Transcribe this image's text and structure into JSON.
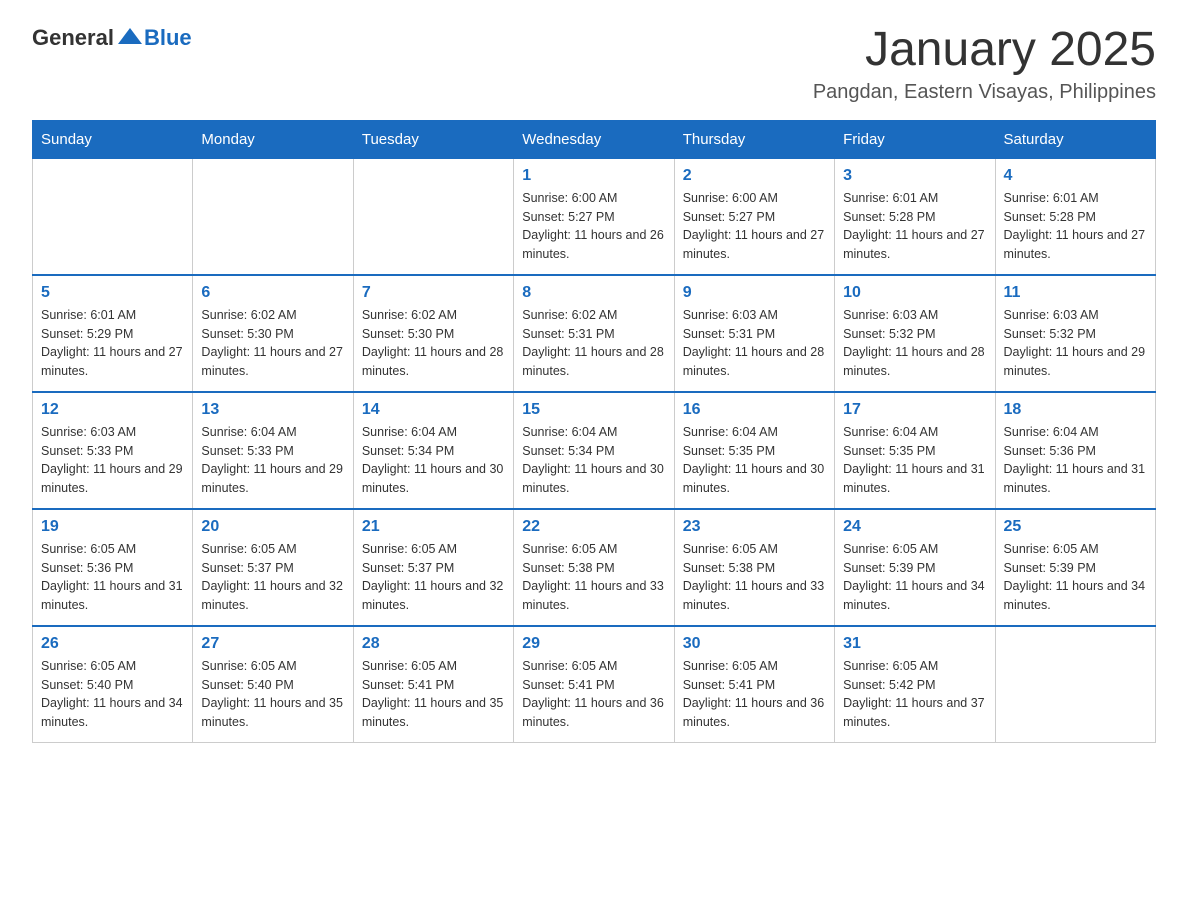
{
  "header": {
    "logo_general": "General",
    "logo_blue": "Blue",
    "month_title": "January 2025",
    "location": "Pangdan, Eastern Visayas, Philippines"
  },
  "days_of_week": [
    "Sunday",
    "Monday",
    "Tuesday",
    "Wednesday",
    "Thursday",
    "Friday",
    "Saturday"
  ],
  "weeks": [
    {
      "days": [
        {
          "num": "",
          "info": ""
        },
        {
          "num": "",
          "info": ""
        },
        {
          "num": "",
          "info": ""
        },
        {
          "num": "1",
          "info": "Sunrise: 6:00 AM\nSunset: 5:27 PM\nDaylight: 11 hours and 26 minutes."
        },
        {
          "num": "2",
          "info": "Sunrise: 6:00 AM\nSunset: 5:27 PM\nDaylight: 11 hours and 27 minutes."
        },
        {
          "num": "3",
          "info": "Sunrise: 6:01 AM\nSunset: 5:28 PM\nDaylight: 11 hours and 27 minutes."
        },
        {
          "num": "4",
          "info": "Sunrise: 6:01 AM\nSunset: 5:28 PM\nDaylight: 11 hours and 27 minutes."
        }
      ]
    },
    {
      "days": [
        {
          "num": "5",
          "info": "Sunrise: 6:01 AM\nSunset: 5:29 PM\nDaylight: 11 hours and 27 minutes."
        },
        {
          "num": "6",
          "info": "Sunrise: 6:02 AM\nSunset: 5:30 PM\nDaylight: 11 hours and 27 minutes."
        },
        {
          "num": "7",
          "info": "Sunrise: 6:02 AM\nSunset: 5:30 PM\nDaylight: 11 hours and 28 minutes."
        },
        {
          "num": "8",
          "info": "Sunrise: 6:02 AM\nSunset: 5:31 PM\nDaylight: 11 hours and 28 minutes."
        },
        {
          "num": "9",
          "info": "Sunrise: 6:03 AM\nSunset: 5:31 PM\nDaylight: 11 hours and 28 minutes."
        },
        {
          "num": "10",
          "info": "Sunrise: 6:03 AM\nSunset: 5:32 PM\nDaylight: 11 hours and 28 minutes."
        },
        {
          "num": "11",
          "info": "Sunrise: 6:03 AM\nSunset: 5:32 PM\nDaylight: 11 hours and 29 minutes."
        }
      ]
    },
    {
      "days": [
        {
          "num": "12",
          "info": "Sunrise: 6:03 AM\nSunset: 5:33 PM\nDaylight: 11 hours and 29 minutes."
        },
        {
          "num": "13",
          "info": "Sunrise: 6:04 AM\nSunset: 5:33 PM\nDaylight: 11 hours and 29 minutes."
        },
        {
          "num": "14",
          "info": "Sunrise: 6:04 AM\nSunset: 5:34 PM\nDaylight: 11 hours and 30 minutes."
        },
        {
          "num": "15",
          "info": "Sunrise: 6:04 AM\nSunset: 5:34 PM\nDaylight: 11 hours and 30 minutes."
        },
        {
          "num": "16",
          "info": "Sunrise: 6:04 AM\nSunset: 5:35 PM\nDaylight: 11 hours and 30 minutes."
        },
        {
          "num": "17",
          "info": "Sunrise: 6:04 AM\nSunset: 5:35 PM\nDaylight: 11 hours and 31 minutes."
        },
        {
          "num": "18",
          "info": "Sunrise: 6:04 AM\nSunset: 5:36 PM\nDaylight: 11 hours and 31 minutes."
        }
      ]
    },
    {
      "days": [
        {
          "num": "19",
          "info": "Sunrise: 6:05 AM\nSunset: 5:36 PM\nDaylight: 11 hours and 31 minutes."
        },
        {
          "num": "20",
          "info": "Sunrise: 6:05 AM\nSunset: 5:37 PM\nDaylight: 11 hours and 32 minutes."
        },
        {
          "num": "21",
          "info": "Sunrise: 6:05 AM\nSunset: 5:37 PM\nDaylight: 11 hours and 32 minutes."
        },
        {
          "num": "22",
          "info": "Sunrise: 6:05 AM\nSunset: 5:38 PM\nDaylight: 11 hours and 33 minutes."
        },
        {
          "num": "23",
          "info": "Sunrise: 6:05 AM\nSunset: 5:38 PM\nDaylight: 11 hours and 33 minutes."
        },
        {
          "num": "24",
          "info": "Sunrise: 6:05 AM\nSunset: 5:39 PM\nDaylight: 11 hours and 34 minutes."
        },
        {
          "num": "25",
          "info": "Sunrise: 6:05 AM\nSunset: 5:39 PM\nDaylight: 11 hours and 34 minutes."
        }
      ]
    },
    {
      "days": [
        {
          "num": "26",
          "info": "Sunrise: 6:05 AM\nSunset: 5:40 PM\nDaylight: 11 hours and 34 minutes."
        },
        {
          "num": "27",
          "info": "Sunrise: 6:05 AM\nSunset: 5:40 PM\nDaylight: 11 hours and 35 minutes."
        },
        {
          "num": "28",
          "info": "Sunrise: 6:05 AM\nSunset: 5:41 PM\nDaylight: 11 hours and 35 minutes."
        },
        {
          "num": "29",
          "info": "Sunrise: 6:05 AM\nSunset: 5:41 PM\nDaylight: 11 hours and 36 minutes."
        },
        {
          "num": "30",
          "info": "Sunrise: 6:05 AM\nSunset: 5:41 PM\nDaylight: 11 hours and 36 minutes."
        },
        {
          "num": "31",
          "info": "Sunrise: 6:05 AM\nSunset: 5:42 PM\nDaylight: 11 hours and 37 minutes."
        },
        {
          "num": "",
          "info": ""
        }
      ]
    }
  ]
}
